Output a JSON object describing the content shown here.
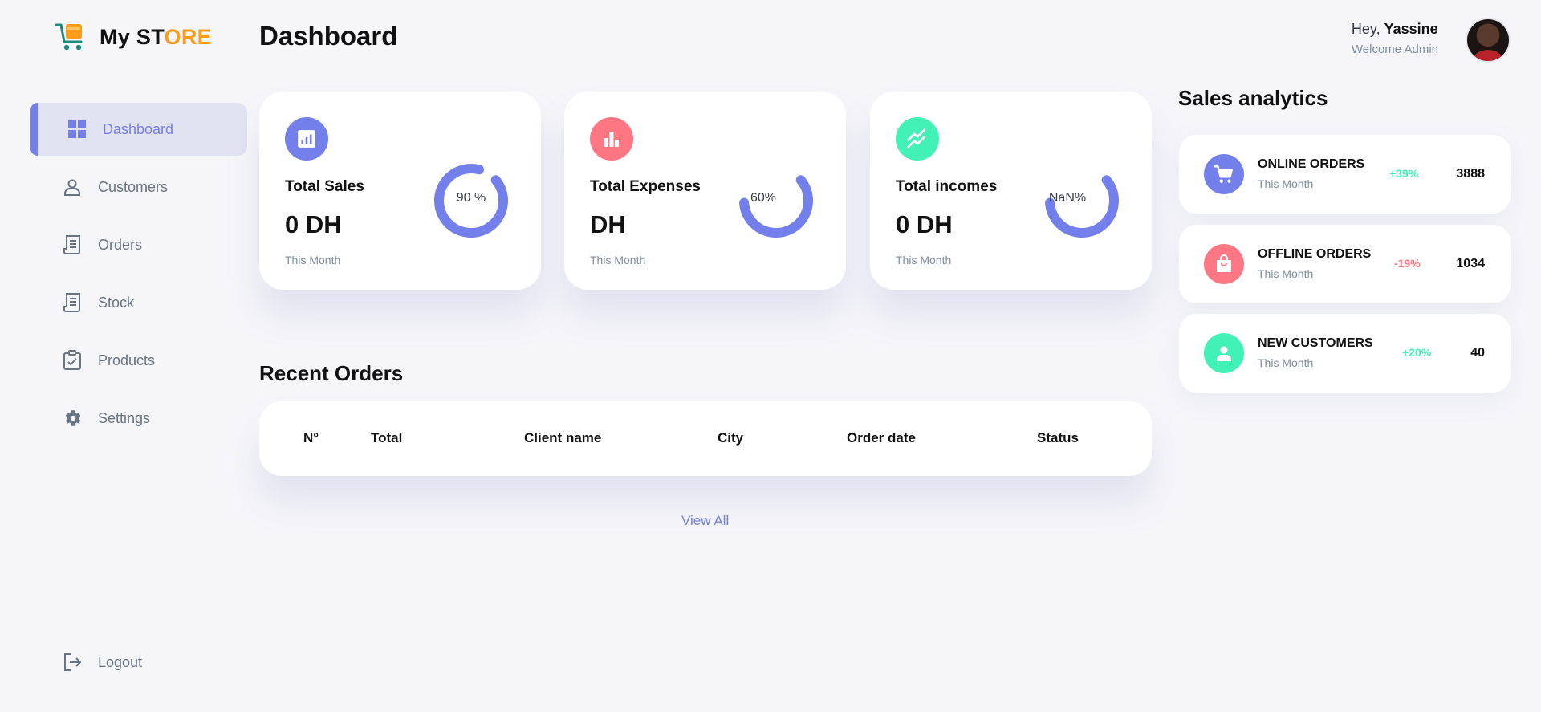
{
  "brand": {
    "text_main": "My ST",
    "text_accent": "ORE"
  },
  "sidebar": {
    "items": [
      {
        "label": "Dashboard",
        "icon": "grid-icon",
        "active": true
      },
      {
        "label": "Customers",
        "icon": "person-icon"
      },
      {
        "label": "Orders",
        "icon": "receipt-icon"
      },
      {
        "label": "Stock",
        "icon": "receipt-icon"
      },
      {
        "label": "Products",
        "icon": "clipboard-check-icon"
      },
      {
        "label": "Settings",
        "icon": "gear-icon"
      }
    ],
    "logout_label": "Logout"
  },
  "header": {
    "title": "Dashboard",
    "greeting_prefix": "Hey,",
    "user_name": "Yassine",
    "role": "Welcome Admin"
  },
  "cards": [
    {
      "title": "Total Sales",
      "value": "0 DH",
      "sub": "This Month",
      "ring_label": "90 %",
      "ring_fraction": 0.9,
      "icon": "chart-icon",
      "color": "#7380ec"
    },
    {
      "title": "Total Expenses",
      "value": "DH",
      "sub": "This Month",
      "ring_label": "60%",
      "ring_fraction": 0.6,
      "icon": "bar-chart-icon",
      "color": "#ff7782"
    },
    {
      "title": "Total incomes",
      "value": "0 DH",
      "sub": "This Month",
      "ring_label": "NaN%",
      "ring_fraction": 0.6,
      "icon": "trend-icon",
      "color": "#41f1b6"
    }
  ],
  "recent_orders": {
    "title": "Recent Orders",
    "columns": [
      "N°",
      "Total",
      "Client name",
      "City",
      "Order date",
      "Status"
    ],
    "view_all": "View All"
  },
  "analytics": {
    "title": "Sales analytics",
    "items": [
      {
        "title": "ONLINE ORDERS",
        "sub": "This Month",
        "pct": "+39%",
        "pct_color": "#41f1b6",
        "value": "3888",
        "icon": "cart-icon",
        "color": "#7380ec"
      },
      {
        "title": "OFFLINE ORDERS",
        "sub": "This Month",
        "pct": "-19%",
        "pct_color": "#ff7782",
        "value": "1034",
        "icon": "bag-icon",
        "color": "#ff7782"
      },
      {
        "title": "NEW CUSTOMERS",
        "sub": "This Month",
        "pct": "+20%",
        "pct_color": "#41f1b6",
        "value": "40",
        "icon": "person-icon",
        "color": "#41f1b6"
      }
    ]
  },
  "colors": {
    "primary": "#7380ec",
    "danger": "#ff7782",
    "success": "#41f1b6",
    "warning": "#ff9d1b"
  }
}
